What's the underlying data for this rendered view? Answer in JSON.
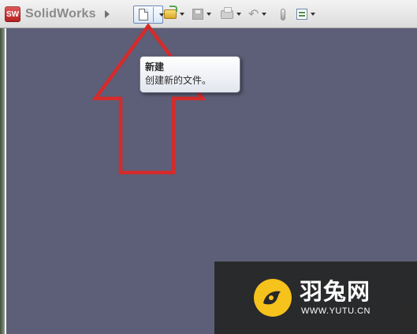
{
  "toolbar": {
    "logo_badge": "SW",
    "logo_text": "SolidWorks",
    "items": [
      {
        "name": "new-document-icon"
      },
      {
        "name": "open-folder-icon"
      },
      {
        "name": "save-disk-icon"
      },
      {
        "name": "print-icon"
      },
      {
        "name": "undo-icon",
        "glyph": "↶"
      },
      {
        "name": "rebuild-icon"
      },
      {
        "name": "options-icon"
      }
    ]
  },
  "tooltip": {
    "title": "新建",
    "description": "创建新的文件。"
  },
  "watermark": {
    "name": "羽兔网",
    "url": "WWW.YUTU.CN"
  },
  "colors": {
    "canvas": "#5d5e77",
    "arrow": "#d52b2b",
    "watermark_bg": "#282828",
    "watermark_logo": "#f6c21c"
  }
}
